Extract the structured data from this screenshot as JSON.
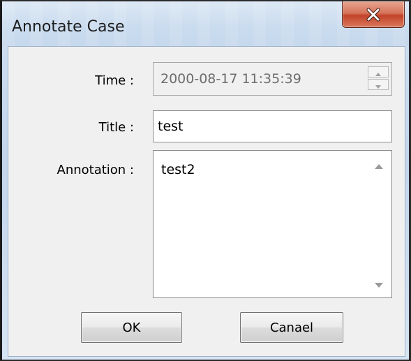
{
  "window": {
    "title": "Annotate Case",
    "close_icon": "close-icon"
  },
  "form": {
    "time_label": "Time :",
    "time_value": "2000-08-17 11:35:39",
    "title_label": "Title :",
    "title_value": "test",
    "annotation_label": "Annotation :",
    "annotation_value": "test2"
  },
  "buttons": {
    "ok_label": "OK",
    "cancel_label": "Canael"
  },
  "icons": {
    "spin_up": "spin-up-icon",
    "spin_down": "spin-down-icon",
    "scroll_up": "scroll-up-arrow-icon",
    "scroll_down": "scroll-down-arrow-icon"
  },
  "colors": {
    "close_button": "#c74a30",
    "dialog_frame": "#c6d8ec",
    "client_background": "#f0f0f0"
  }
}
